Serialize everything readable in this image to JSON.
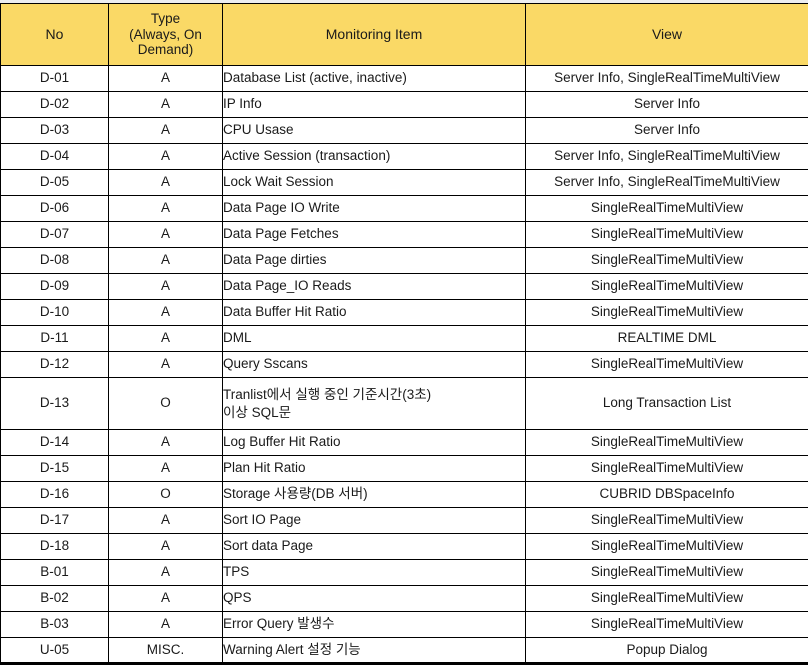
{
  "table": {
    "columns": [
      {
        "key": "no",
        "label": "No"
      },
      {
        "key": "type",
        "label": "Type\n(Always, On Demand)"
      },
      {
        "key": "item",
        "label": "Monitoring Item"
      },
      {
        "key": "view",
        "label": "View"
      }
    ],
    "header_labels": {
      "no": "No",
      "type_line1": "Type",
      "type_line2": "(Always, On",
      "type_line3": "Demand)",
      "item": "Monitoring Item",
      "view": "View"
    },
    "colors": {
      "header_background": "#FAD966",
      "header_text": "#1A1A1A",
      "body_background": "#FFFFFF",
      "body_text": "#1A1A1A",
      "grid_line": "#000000",
      "top_strip": "#ECEEF0"
    },
    "rows": [
      {
        "no": "D-01",
        "type": "A",
        "item": "Database List (active, inactive)",
        "view": "Server Info, SingleRealTimeMultiView",
        "tall": false
      },
      {
        "no": "D-02",
        "type": "A",
        "item": "IP Info",
        "view": "Server Info",
        "tall": false
      },
      {
        "no": "D-03",
        "type": "A",
        "item": "CPU Usase",
        "view": "Server Info",
        "tall": false
      },
      {
        "no": "D-04",
        "type": "A",
        "item": "Active Session (transaction)",
        "view": "Server Info, SingleRealTimeMultiView",
        "tall": false
      },
      {
        "no": "D-05",
        "type": "A",
        "item": "Lock Wait Session",
        "view": "Server Info, SingleRealTimeMultiView",
        "tall": false
      },
      {
        "no": "D-06",
        "type": "A",
        "item": "Data Page IO Write",
        "view": "SingleRealTimeMultiView",
        "tall": false
      },
      {
        "no": "D-07",
        "type": "A",
        "item": "Data Page Fetches",
        "view": "SingleRealTimeMultiView",
        "tall": false
      },
      {
        "no": "D-08",
        "type": "A",
        "item": "Data Page dirties",
        "view": "SingleRealTimeMultiView",
        "tall": false
      },
      {
        "no": "D-09",
        "type": "A",
        "item": "Data Page_IO Reads",
        "view": "SingleRealTimeMultiView",
        "tall": false
      },
      {
        "no": "D-10",
        "type": "A",
        "item": "Data Buffer Hit Ratio",
        "view": "SingleRealTimeMultiView",
        "tall": false
      },
      {
        "no": "D-11",
        "type": "A",
        "item": "DML",
        "view": "REALTIME DML",
        "tall": false
      },
      {
        "no": "D-12",
        "type": "A",
        "item": "Query Sscans",
        "view": "SingleRealTimeMultiView",
        "tall": false
      },
      {
        "no": "D-13",
        "type": "O",
        "item": "Tranlist에서 실행 중인 기준시간(3초)\n이상 SQL문",
        "view": "Long Transaction List",
        "tall": true
      },
      {
        "no": "D-14",
        "type": "A",
        "item": "Log Buffer Hit Ratio",
        "view": "SingleRealTimeMultiView",
        "tall": false
      },
      {
        "no": "D-15",
        "type": "A",
        "item": "Plan Hit Ratio",
        "view": "SingleRealTimeMultiView",
        "tall": false
      },
      {
        "no": "D-16",
        "type": "O",
        "item": "Storage 사용량(DB 서버)",
        "view": "CUBRID DBSpaceInfo",
        "tall": false
      },
      {
        "no": "D-17",
        "type": "A",
        "item": "Sort IO Page",
        "view": "SingleRealTimeMultiView",
        "tall": false
      },
      {
        "no": "D-18",
        "type": "A",
        "item": "Sort data Page",
        "view": "SingleRealTimeMultiView",
        "tall": false
      },
      {
        "no": "B-01",
        "type": "A",
        "item": "TPS",
        "view": "SingleRealTimeMultiView",
        "tall": false
      },
      {
        "no": "B-02",
        "type": "A",
        "item": "QPS",
        "view": "SingleRealTimeMultiView",
        "tall": false
      },
      {
        "no": "B-03",
        "type": "A",
        "item": "Error Query 발생수",
        "view": "SingleRealTimeMultiView",
        "tall": false
      },
      {
        "no": "U-05",
        "type": "MISC.",
        "item": "Warning Alert 설정 기능",
        "view": "Popup Dialog",
        "tall": false
      }
    ]
  }
}
